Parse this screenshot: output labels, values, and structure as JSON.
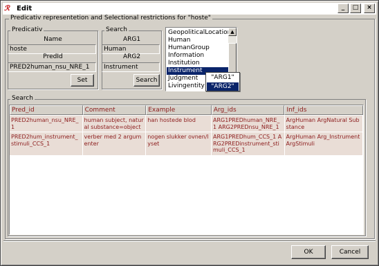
{
  "window": {
    "title": "Edit",
    "app_icon": "ℛ",
    "minimize": "_",
    "maximize": "□",
    "close": "×"
  },
  "outer_group": {
    "legend": "Predicativ representetion and Selectional restrictions for \"hoste\""
  },
  "predicativ": {
    "legend": "Predicativ",
    "name_label": "Name",
    "name_value": "hoste",
    "predid_label": "PredId",
    "predid_value": "PRED2human_nsu_NRE_1",
    "set_button": "Set"
  },
  "search_group": {
    "legend": "Search",
    "arg1_label": "ARG1",
    "arg1_value": "Human",
    "arg2_label": "ARG2",
    "arg2_value": "Instrument",
    "search_button": "Search"
  },
  "list": {
    "items": [
      "GeopoliticalLocation",
      "Human",
      "HumanGroup",
      "Information",
      "Institution",
      "Instrument",
      "Judgment",
      "Livingentity"
    ],
    "selected": "Instrument"
  },
  "popup": {
    "items": [
      "\"ARG1\"",
      "\"ARG2\""
    ],
    "selected": "\"ARG2\""
  },
  "results": {
    "legend": "Search",
    "columns": [
      "Pred_id",
      "Comment",
      "Example",
      "Arg_ids",
      "Inf_ids"
    ],
    "rows": [
      [
        "PRED2human_nsu_NRE_1",
        "human subject, natural substance=object",
        "han hostede blod",
        "ARG1PREDhuman_NRE_1 ARG2PREDnsu_NRE_1",
        "ArgHuman ArgNatural Substance"
      ],
      [
        "PRED2hum_instrument_stimuli_CCS_1",
        "verber med 2 argumenter",
        "nogen slukker ovnen/lyset",
        "ARG1PREDhum_CCS_1 ARG2PREDinstrument_stimuli_CCS_1",
        "ArgHuman Arg_Instrument ArgStimuli"
      ]
    ]
  },
  "footer": {
    "ok": "OK",
    "cancel": "Cancel"
  }
}
